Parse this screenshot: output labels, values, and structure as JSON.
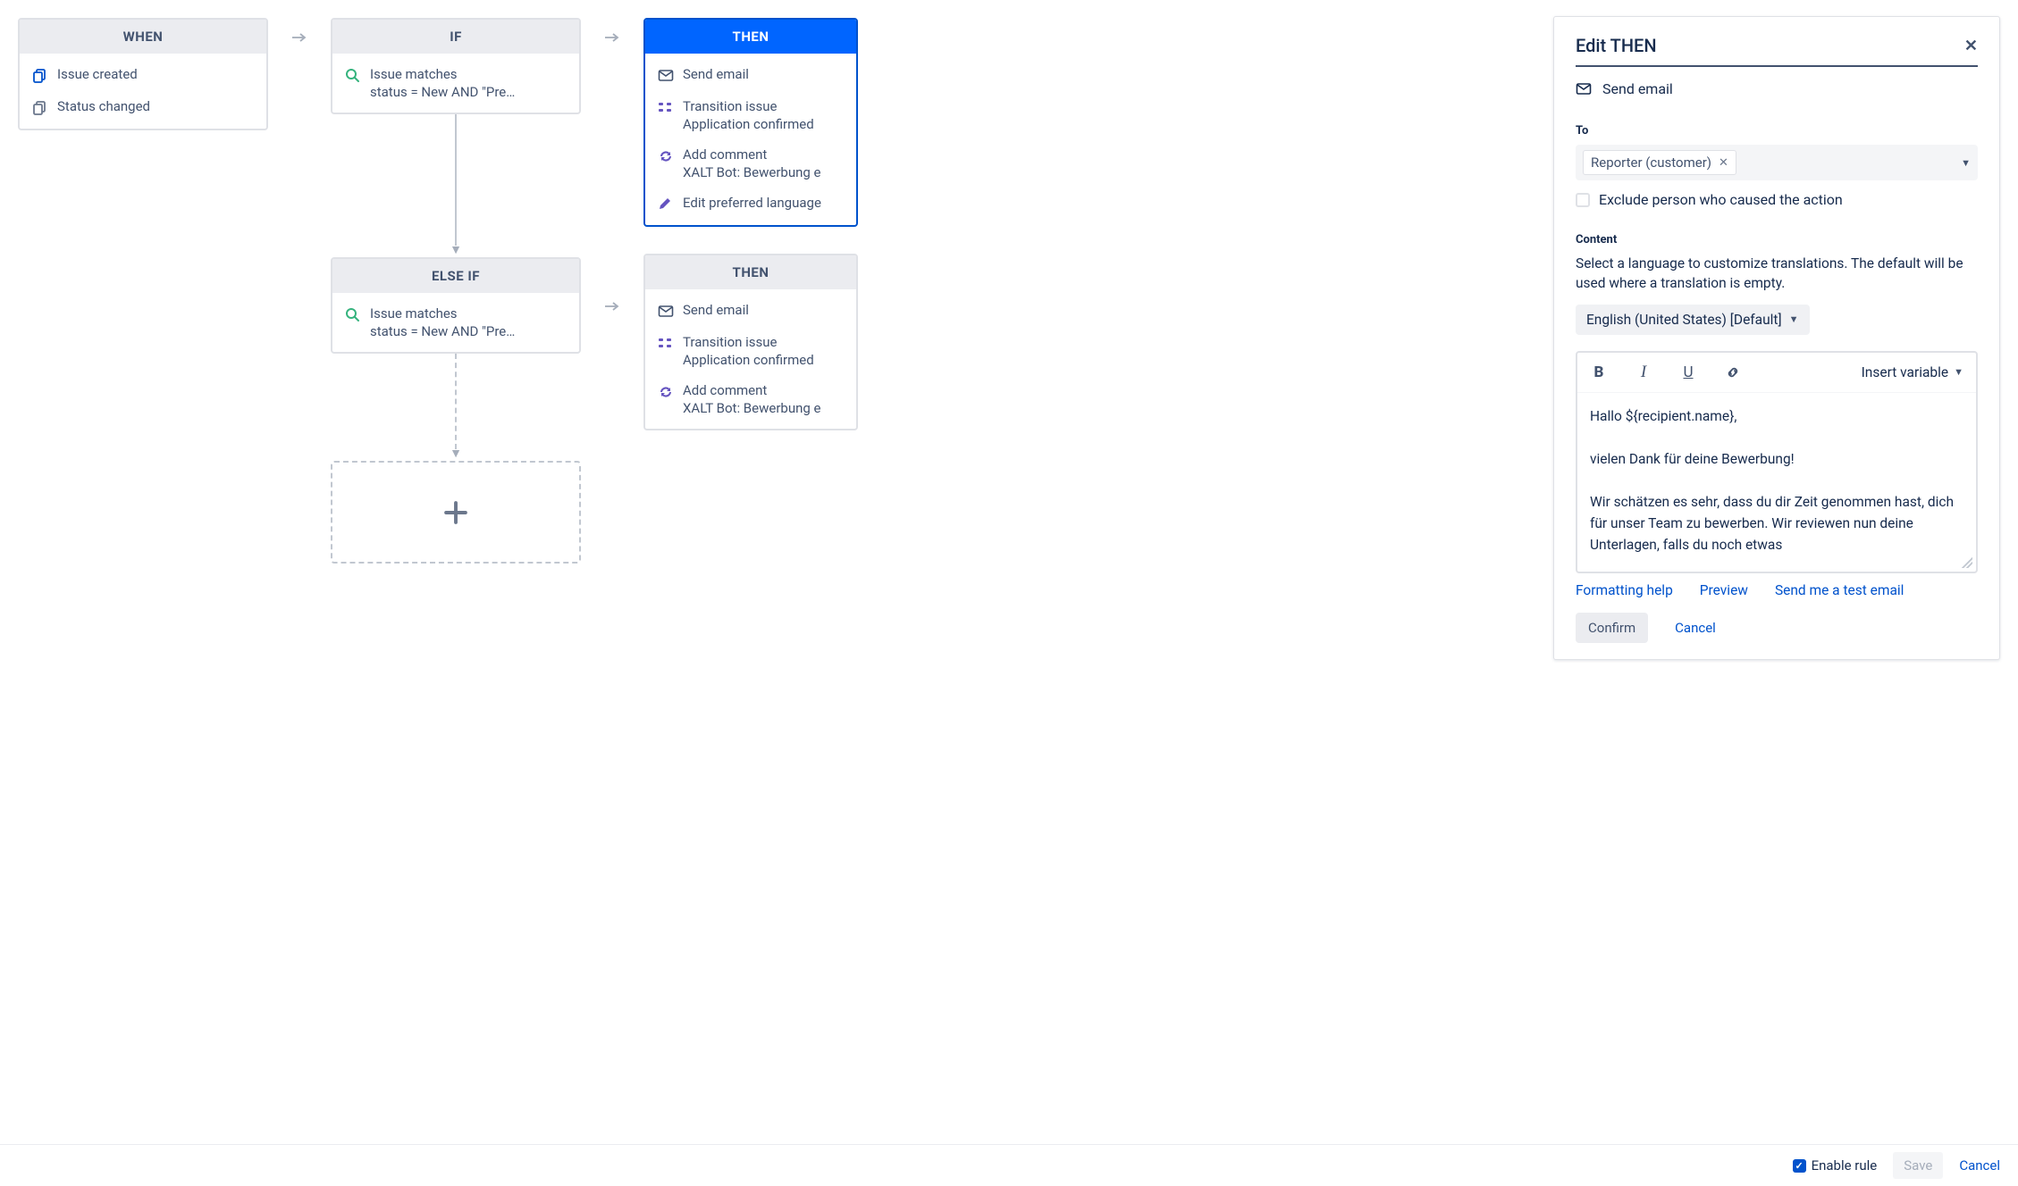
{
  "when": {
    "header": "WHEN",
    "items": [
      {
        "icon": "copy-icon-blue",
        "title": "Issue created"
      },
      {
        "icon": "copy-icon-gray",
        "title": "Status changed"
      }
    ]
  },
  "if": {
    "header": "IF",
    "items": [
      {
        "icon": "search-icon",
        "title": "Issue matches",
        "sub": "status = New AND \"Pre…"
      }
    ]
  },
  "then1": {
    "header": "THEN",
    "items": [
      {
        "icon": "mail-icon",
        "title": "Send email"
      },
      {
        "icon": "transition-icon",
        "title": "Transition issue",
        "sub": "Application confirmed"
      },
      {
        "icon": "refresh-icon",
        "title": "Add comment",
        "sub": "XALT Bot: Bewerbung e"
      },
      {
        "icon": "pencil-icon",
        "title": "Edit preferred language"
      }
    ]
  },
  "elseif": {
    "header": "ELSE IF",
    "items": [
      {
        "icon": "search-icon",
        "title": "Issue matches",
        "sub": "status = New AND \"Pre…"
      }
    ]
  },
  "then2": {
    "header": "THEN",
    "items": [
      {
        "icon": "mail-icon",
        "title": "Send email"
      },
      {
        "icon": "transition-icon",
        "title": "Transition issue",
        "sub": "Application confirmed"
      },
      {
        "icon": "refresh-icon",
        "title": "Add comment",
        "sub": "XALT Bot: Bewerbung e"
      }
    ]
  },
  "panel": {
    "title": "Edit THEN",
    "action_label": "Send email",
    "to_label": "To",
    "to_chip": "Reporter (customer)",
    "exclude_label": "Exclude person who caused the action",
    "content_label": "Content",
    "content_desc": "Select a language to customize translations. The default will be used where a translation is empty.",
    "language": "English (United States) [Default]",
    "insert_variable": "Insert variable",
    "editor_body": "Hallo ${recipient.name},\n\nvielen Dank für deine Bewerbung!\n\nWir schätzen es sehr, dass du dir Zeit genommen hast, dich für unser Team zu bewerben. Wir reviewen nun deine Unterlagen, falls du noch etwas",
    "links": {
      "formatting": "Formatting help",
      "preview": "Preview",
      "test_email": "Send me a test email"
    },
    "confirm": "Confirm",
    "cancel": "Cancel"
  },
  "footer": {
    "enable_rule": "Enable rule",
    "save": "Save",
    "cancel": "Cancel"
  },
  "colors": {
    "blue": "#0065FF",
    "link": "#0052CC",
    "green": "#36B37E",
    "purple": "#6554C0",
    "gray": "#42526E"
  }
}
